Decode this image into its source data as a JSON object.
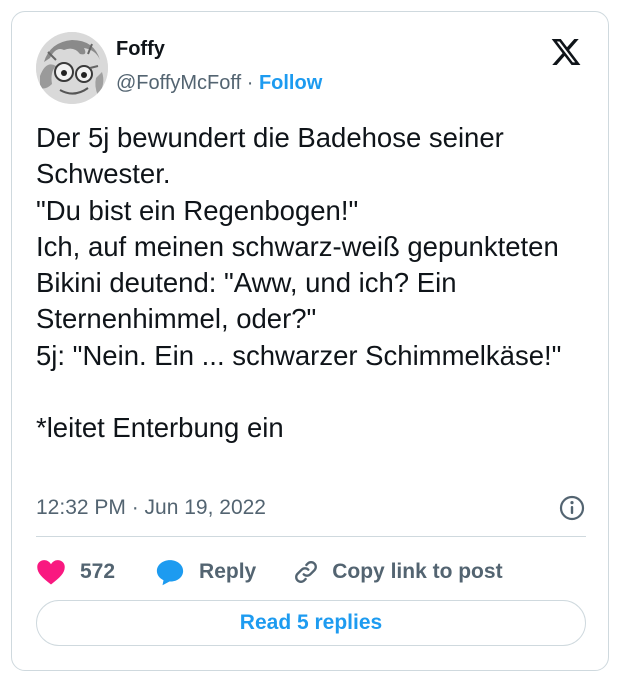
{
  "author": {
    "name": "Foffy",
    "handle": "@FoffyMcFoff",
    "separator": " · ",
    "follow_label": "Follow"
  },
  "tweet": {
    "text": "Der 5j bewundert die Badehose seiner Schwester.\n\"Du bist ein Regenbogen!\"\nIch, auf meinen schwarz-weiß gepunkteten Bikini deutend: \"Aww, und ich? Ein Sternenhimmel, oder?\"\n5j: \"Nein. Ein ... schwarzer Schimmelkäse!\"\n\n*leitet Enterbung ein",
    "timestamp": "12:32 PM · Jun 19, 2022"
  },
  "actions": {
    "like_count": "572",
    "reply_label": "Reply",
    "copy_link_label": "Copy link to post"
  },
  "read_replies_label": "Read 5 replies",
  "colors": {
    "accent": "#1d9bf0",
    "like": "#f91880",
    "text": "#0f1419",
    "secondary": "#536471",
    "border": "#cfd9de"
  },
  "icons": {
    "brand": "x-logo-icon",
    "info": "info-icon",
    "like": "heart-icon",
    "reply": "speech-bubble-icon",
    "copy": "link-icon"
  }
}
